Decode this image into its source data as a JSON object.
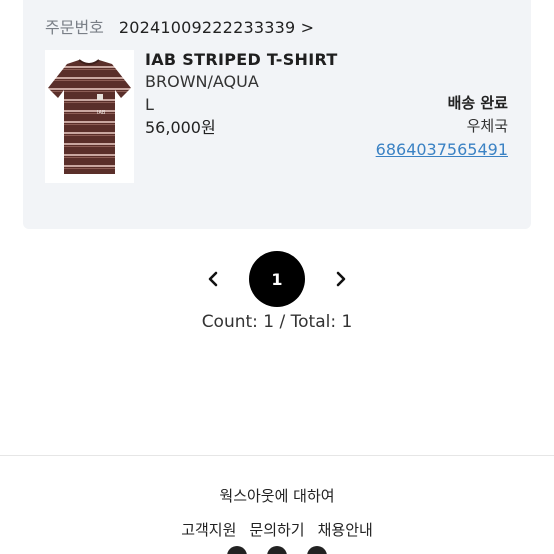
{
  "order": {
    "number_label": "주문번호",
    "number_value": "20241009222233339 >"
  },
  "product": {
    "image_icon": "striped-tshirt-image",
    "name": "IAB STRIPED T-SHIRT",
    "color": "BROWN/AQUA",
    "size": "L",
    "price": "56,000원"
  },
  "shipping": {
    "status": "배송 완료",
    "courier": "우체국",
    "tracking_number": "6864037565491"
  },
  "pagination": {
    "prev_icon": "chevron-left-icon",
    "current_page": "1",
    "next_icon": "chevron-right-icon",
    "count_text": "Count: 1 / Total: 1"
  },
  "footer": {
    "about": "웍스아웃에 대하여",
    "links": [
      "고객지원",
      "문의하기",
      "채용안내"
    ]
  },
  "colors": {
    "card_bg": "#f2f4f7",
    "link": "#3b82c4",
    "page_active_bg": "#000000"
  }
}
